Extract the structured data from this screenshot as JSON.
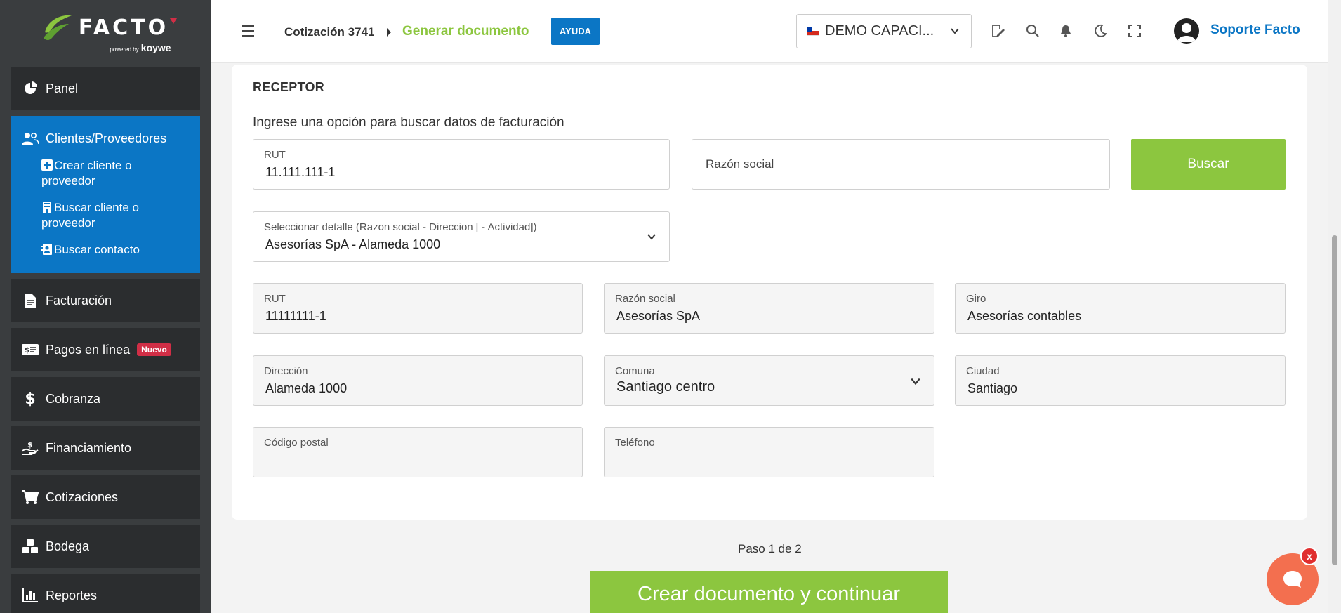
{
  "brand": {
    "logo_text": "FACTO",
    "powered_by": "powered by",
    "partner": "koywe",
    "accent_green": "#8cc63f",
    "accent_blue": "#0b76c5",
    "sidebar_bg": "#3a3d3f"
  },
  "sidebar": {
    "items": [
      {
        "label": "Panel",
        "icon": "pie-chart-icon"
      },
      {
        "label": "Clientes/Proveedores",
        "icon": "users-icon",
        "active": true,
        "children": [
          {
            "label": "Crear cliente o proveedor",
            "icon": "plus-square-icon"
          },
          {
            "label": "Buscar cliente o proveedor",
            "icon": "building-icon"
          },
          {
            "label": "Buscar contacto",
            "icon": "contact-card-icon"
          }
        ]
      },
      {
        "label": "Facturación",
        "icon": "document-icon"
      },
      {
        "label": "Pagos en línea",
        "icon": "money-bill-icon",
        "badge": "Nuevo"
      },
      {
        "label": "Cobranza",
        "icon": "dollar-icon"
      },
      {
        "label": "Financiamiento",
        "icon": "hand-money-icon"
      },
      {
        "label": "Cotizaciones",
        "icon": "cart-icon"
      },
      {
        "label": "Bodega",
        "icon": "boxes-icon"
      },
      {
        "label": "Reportes",
        "icon": "bar-chart-icon"
      }
    ]
  },
  "topbar": {
    "breadcrumb_1": "Cotización 3741",
    "breadcrumb_2": "Generar documento",
    "help_label": "AYUDA",
    "company_selector": "DEMO CAPACI...",
    "user_name": "Soporte Facto"
  },
  "receptor": {
    "title": "RECEPTOR",
    "instructions": "Ingrese una opción para buscar datos de facturación",
    "search_rut_label": "RUT",
    "search_rut_value": "11.111.111-1",
    "search_razon_placeholder": "Razón social",
    "search_button": "Buscar",
    "detail_label": "Seleccionar detalle (Razon social - Direccion [ - Actividad])",
    "detail_value": "Asesorías SpA - Alameda 1000",
    "fields": {
      "rut": {
        "label": "RUT",
        "value": "11111111-1"
      },
      "razon_social": {
        "label": "Razón social",
        "value": "Asesorías SpA"
      },
      "giro": {
        "label": "Giro",
        "value": "Asesorías contables"
      },
      "direccion": {
        "label": "Dirección",
        "value": "Alameda 1000"
      },
      "comuna": {
        "label": "Comuna",
        "value": "Santiago centro"
      },
      "ciudad": {
        "label": "Ciudad",
        "value": "Santiago"
      },
      "codigo_postal": {
        "label": "Código postal",
        "value": ""
      },
      "telefono": {
        "label": "Teléfono",
        "value": ""
      }
    }
  },
  "footer": {
    "step_text": "Paso 1 de 2",
    "primary_button": "Crear documento y continuar"
  },
  "chat": {
    "close_label": "x"
  }
}
